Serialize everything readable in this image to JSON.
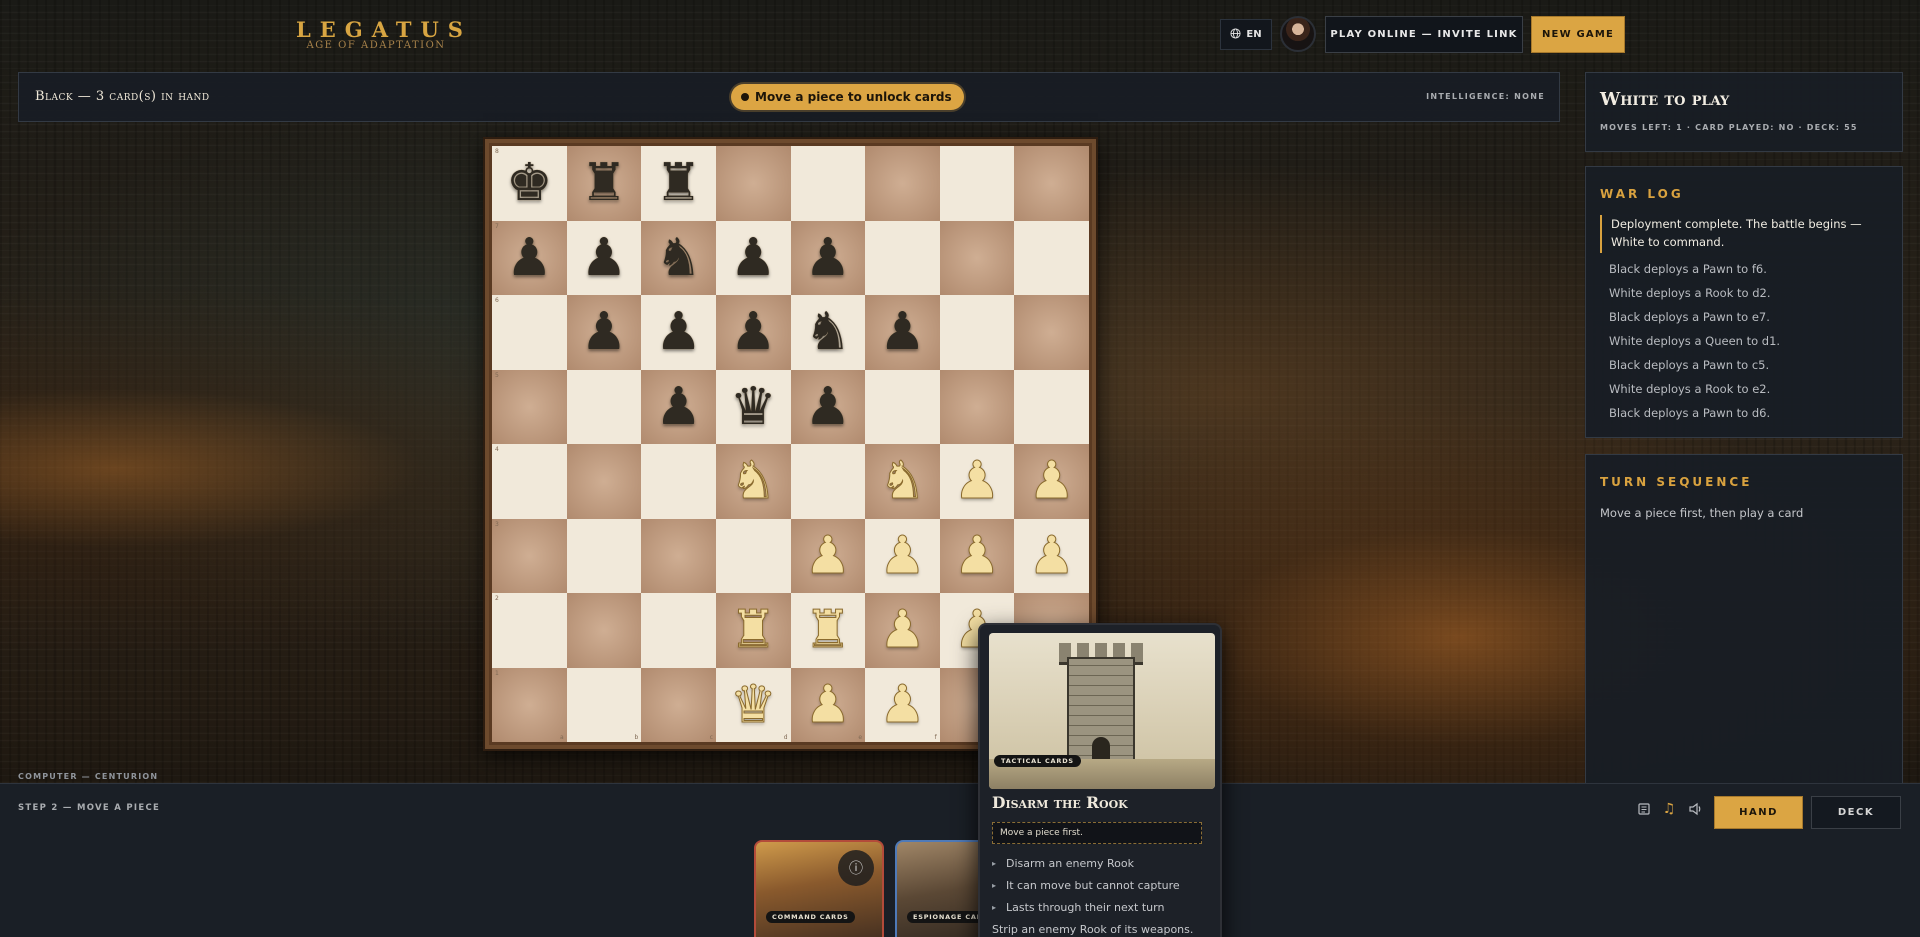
{
  "header": {
    "logo_title": "LEGATUS",
    "logo_subtitle": "AGE OF ADAPTATION",
    "language": "EN",
    "invite_label": "PLAY ONLINE — INVITE LINK",
    "new_game_label": "NEW GAME"
  },
  "opponent_bar": {
    "title": "Black — 3 card(s) in hand",
    "unlock_pill": "Move a piece to unlock cards",
    "intelligence": "INTELLIGENCE: NONE"
  },
  "board": {
    "ranks": [
      "8",
      "7",
      "6",
      "5",
      "4",
      "3",
      "2",
      "1"
    ],
    "files": [
      "a",
      "b",
      "c",
      "d",
      "e",
      "f",
      "g",
      "h"
    ],
    "rows": [
      [
        "bK",
        "bR",
        "bR",
        "",
        "",
        "",
        "",
        ""
      ],
      [
        "bP",
        "bP",
        "bN",
        "bP",
        "bP",
        "",
        "",
        ""
      ],
      [
        "",
        "bP",
        "bP",
        "bP",
        "bN",
        "bP",
        "",
        ""
      ],
      [
        "",
        "",
        "bP",
        "bQ",
        "bP",
        "",
        "",
        ""
      ],
      [
        "",
        "",
        "",
        "wN",
        "",
        "wN",
        "wP",
        "wP"
      ],
      [
        "",
        "",
        "",
        "",
        "wP",
        "wP",
        "wP",
        "wP"
      ],
      [
        "",
        "",
        "",
        "wR",
        "wR",
        "wP",
        "wP",
        ""
      ],
      [
        "",
        "",
        "",
        "wQ",
        "wP",
        "wP",
        "",
        ""
      ]
    ],
    "glyphs": {
      "K": "♚",
      "Q": "♛",
      "R": "♜",
      "B": "♝",
      "N": "♞",
      "P": "♟"
    }
  },
  "turn_panel": {
    "title": "White to play",
    "info": "MOVES LEFT: 1 · CARD PLAYED: NO · DECK: 55"
  },
  "war_log": {
    "heading": "WAR LOG",
    "entries": [
      "Deployment complete. The battle begins — White to command.",
      "Black deploys a Pawn to f6.",
      "White deploys a Rook to d2.",
      "Black deploys a Pawn to e7.",
      "White deploys a Queen to d1.",
      "Black deploys a Pawn to c5.",
      "White deploys a Rook to e2.",
      "Black deploys a Pawn to d6."
    ]
  },
  "turn_sequence": {
    "heading": "TURN SEQUENCE",
    "text": "Move a piece first, then play a card"
  },
  "bottom": {
    "computer_label": "COMPUTER — CENTURION",
    "step_label": "STEP 2 — MOVE A PIECE",
    "hand_label": "HAND",
    "deck_label": "DECK",
    "icons": [
      "scroll-icon",
      "music-icon",
      "speaker-icon"
    ]
  },
  "hand_cards": [
    {
      "tag": "COMMAND CARDS",
      "accent": "#b34b3a"
    },
    {
      "tag": "ESPIONAGE CARDS",
      "accent": "#4f7ab8"
    }
  ],
  "preview_card": {
    "tag": "TACTICAL CARDS",
    "title": "Disarm the Rook",
    "note": "Move a piece first.",
    "bullets": [
      "Disarm an enemy Rook",
      "It can move but cannot capture",
      "Lasts through their next turn"
    ],
    "description": "Strip an enemy Rook of its weapons."
  },
  "colors": {
    "accent": "#dba543",
    "panel_bg": "#181d24",
    "light_square": "#f1e9da",
    "dark_square": "#b08a6e"
  }
}
